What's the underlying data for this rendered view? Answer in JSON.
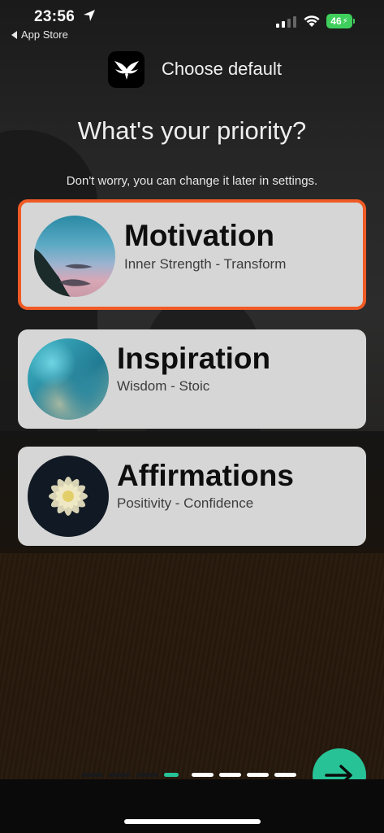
{
  "status_bar": {
    "time": "23:56",
    "back_label": "App Store",
    "battery": "46"
  },
  "header": {
    "label": "Choose default"
  },
  "title": "What's your priority?",
  "subtitle": "Don't worry, you can change it later in settings.",
  "categories": [
    {
      "title": "Motivation",
      "subtitle": "Inner Strength - Transform",
      "selected": true
    },
    {
      "title": "Inspiration",
      "subtitle": "Wisdom - Stoic",
      "selected": false
    },
    {
      "title": "Affirmations",
      "subtitle": "Positivity - Confidence",
      "selected": false
    }
  ],
  "pagination": {
    "total": 8,
    "active_index": 3
  },
  "colors": {
    "accent": "#f05a24",
    "next_button": "#27c397",
    "active_dot": "#27c397",
    "inactive_dot": "#ffffff",
    "past_dot": "#1a1a1a"
  },
  "icons": {
    "app": "phoenix-logo-icon",
    "next": "arrow-right-icon",
    "location": "location-arrow-icon",
    "signal": "cellular-signal-icon",
    "wifi": "wifi-icon",
    "battery": "battery-charging-icon"
  }
}
